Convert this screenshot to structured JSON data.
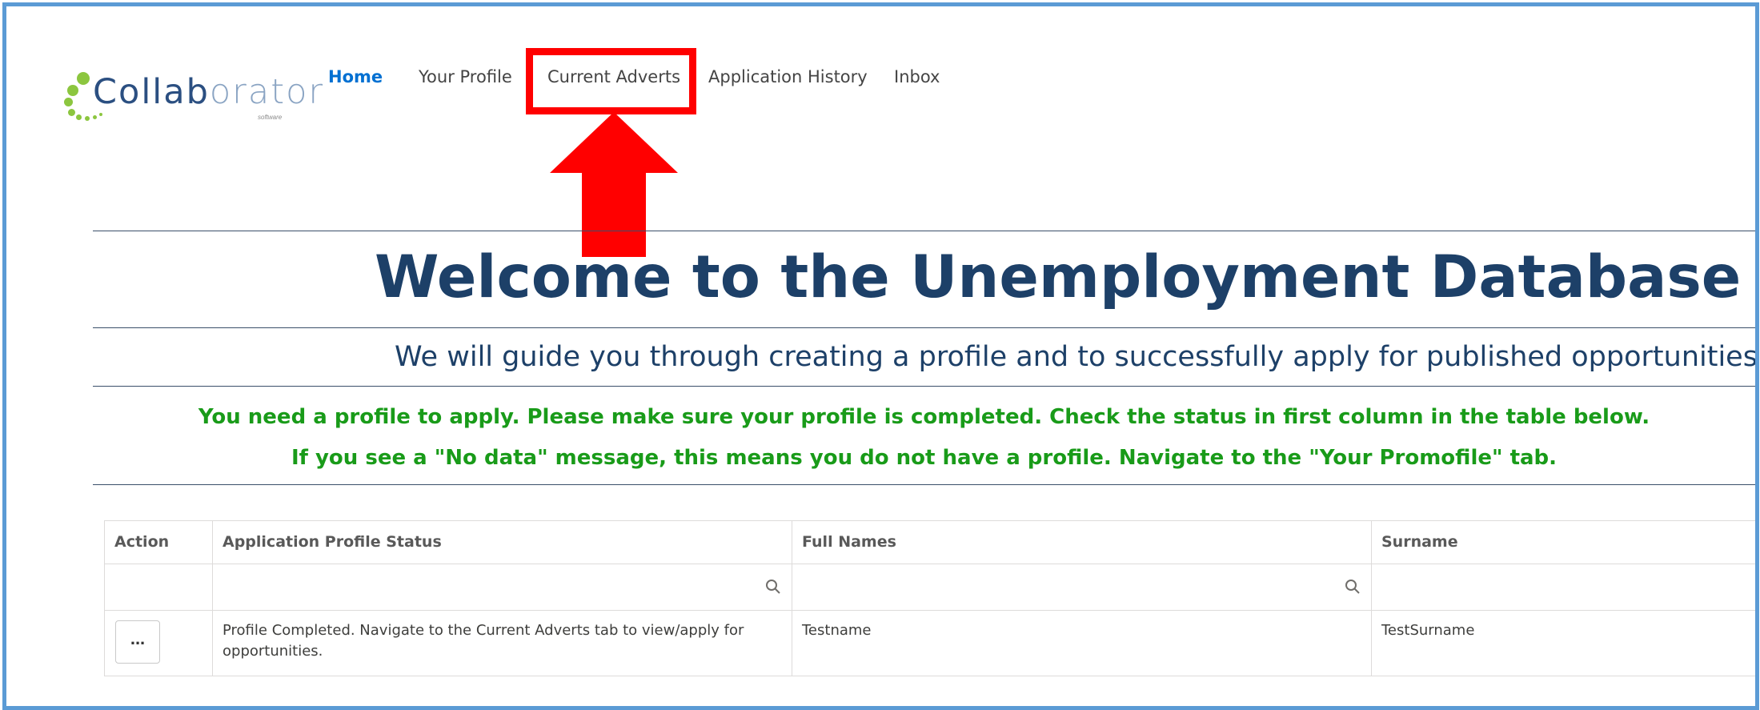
{
  "logo": {
    "text_strong": "Collab",
    "text_light": "orator",
    "subtext": "software"
  },
  "nav": {
    "items": [
      {
        "label": "Home",
        "active": true
      },
      {
        "label": "Your Profile",
        "active": false
      },
      {
        "label": "Current Adverts",
        "active": false,
        "highlighted": true
      },
      {
        "label": "Application History",
        "active": false
      },
      {
        "label": "Inbox",
        "active": false
      }
    ]
  },
  "annotation": {
    "color": "#ff0000",
    "shape": "arrow-up"
  },
  "page": {
    "title": "Welcome to the Unemployment Database Portal",
    "subtitle": "We will guide you through creating a profile and to successfully apply for published opportunities.",
    "notice_line1": "You need a profile to apply. Please make sure your profile is completed. Check the status in first column in the table below.",
    "notice_line2": "If you see a \"No data\" message, this means you do not have a profile. Navigate to the \"Your Promofile\" tab."
  },
  "table": {
    "columns": [
      "Action",
      "Application Profile Status",
      "Full Names",
      "Surname"
    ],
    "rows": [
      {
        "action_label": "...",
        "status": "Profile Completed. Navigate to the Current Adverts tab to view/apply for opportunities.",
        "status_line1": "Profile Completed. Navigate to the Current Adverts tab to view/apply for",
        "status_line2": "opportunities.",
        "full_names": "Testname",
        "surname": "TestSurname"
      }
    ]
  },
  "colors": {
    "title": "#1d4068",
    "notice": "#199b19",
    "nav_active": "#0070d2",
    "frame": "#5b9bd5"
  }
}
